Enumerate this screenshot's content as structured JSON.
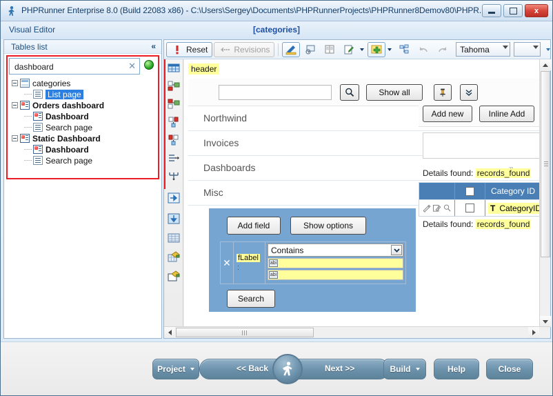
{
  "window": {
    "title": "PHPRunner Enterprise 8.0 (Build 22083 x86) - C:\\Users\\Sergey\\Documents\\PHPRunnerProjects\\PHPRunner8Demov80\\PHPR...",
    "app_icon": "phprunner-icon",
    "minimize_label": "Minimize",
    "maximize_label": "Maximize",
    "close_label": "x"
  },
  "menustrip": {
    "visual_editor": "Visual Editor",
    "current_table": "[categories]"
  },
  "sidebar": {
    "header": "Tables list",
    "collapse_icon": "«",
    "filter": {
      "value": "dashboard",
      "placeholder": "",
      "clear_icon": "✕",
      "status_color": "#2fa82a"
    },
    "tree": [
      {
        "label": "categories",
        "icon": "table-icon",
        "level": 0,
        "bold": false,
        "selected": false,
        "expander": true
      },
      {
        "label": "List page",
        "icon": "page-icon",
        "level": 1,
        "bold": false,
        "selected": true,
        "expander": false
      },
      {
        "label": "Orders dashboard",
        "icon": "dashboard-icon",
        "level": 0,
        "bold": true,
        "selected": false,
        "expander": true
      },
      {
        "label": "Dashboard",
        "icon": "dashboard-icon",
        "level": 1,
        "bold": true,
        "selected": false,
        "expander": false
      },
      {
        "label": "Search page",
        "icon": "page-icon",
        "level": 1,
        "bold": false,
        "selected": false,
        "expander": false
      },
      {
        "label": "Static Dashboard",
        "icon": "dashboard-icon",
        "level": 0,
        "bold": true,
        "selected": false,
        "expander": true
      },
      {
        "label": "Dashboard",
        "icon": "dashboard-icon",
        "level": 1,
        "bold": true,
        "selected": false,
        "expander": false
      },
      {
        "label": "Search page",
        "icon": "page-icon",
        "level": 1,
        "bold": false,
        "selected": false,
        "expander": false
      }
    ]
  },
  "toolbar": {
    "reset_label": "Reset",
    "revisions_label": "Revisions",
    "icons": [
      "style-editor-icon",
      "tooltip-icon",
      "copy-pages-icon",
      "edit-icon",
      "add-icon",
      "structure-icon",
      "undo-icon",
      "redo-icon"
    ],
    "font_name": "Tahoma",
    "font_size": "",
    "overflow_icon": "chevron-down-icon"
  },
  "vrail": {
    "icons": [
      "grid-layout-icon",
      "insert-column-right-icon",
      "insert-column-left-icon",
      "insert-row-below-icon",
      "insert-row-above-icon",
      "merge-cells-icon",
      "split-cells-icon",
      "move-right-icon",
      "move-down-icon",
      "table-properties-icon",
      "cell-color-icon",
      "background-color-icon"
    ]
  },
  "canvas": {
    "header_tag": "header",
    "search": {
      "input_value": "",
      "magnifier_icon": "search-icon",
      "show_all_label": "Show all",
      "pin_icon": "pin-icon",
      "chevron_icon": "chevron-double-down-icon"
    },
    "menu_items": [
      {
        "label": "Northwind",
        "chevron": "»"
      },
      {
        "label": "Invoices",
        "chevron": ""
      },
      {
        "label": "Dashboards",
        "chevron": "»"
      },
      {
        "label": "Misc",
        "chevron": "»"
      }
    ],
    "search_panel": {
      "background": "#77a5d2",
      "add_field_label": "Add field",
      "show_options_label": "Show options",
      "search_label": "Search",
      "remove_icon": "✕",
      "field_label": "fLabel",
      "field_colon": ":",
      "condition_value": "Contains",
      "value_icon_1": "abi",
      "value_icon_2": "abi"
    },
    "right_column": {
      "add_new_label": "Add new",
      "inline_add_label": "Inline Add",
      "details_found_label": "Details found:",
      "records_found_token": "records_found",
      "grid": {
        "headers": [
          "",
          "",
          "Category ID"
        ],
        "row": {
          "actions": [
            "edit-icon",
            "inline-edit-icon",
            "view-icon"
          ],
          "checkbox": "",
          "value_prefix": "T",
          "value": "CategoryID"
        }
      }
    }
  },
  "bottombar": {
    "project_label": "Project",
    "back_label": "<< Back",
    "next_label": "Next >>",
    "run_icon": "run-icon",
    "build_label": "Build",
    "help_label": "Help",
    "close_label": "Close"
  }
}
